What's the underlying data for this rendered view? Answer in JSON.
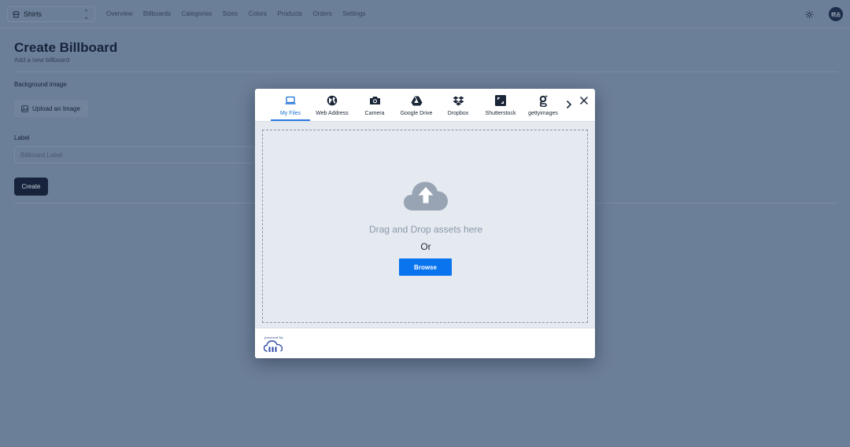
{
  "store_switcher": {
    "label": "Shirts"
  },
  "nav": {
    "items": [
      "Overview",
      "Billboards",
      "Categories",
      "Sizes",
      "Colors",
      "Products",
      "Orders",
      "Settings"
    ]
  },
  "user": {
    "avatar_text": "精选"
  },
  "page": {
    "title": "Create Billboard",
    "subtitle": "Add a new billboard",
    "background_label": "Background image",
    "upload_label": "Upload an Image",
    "label_field_label": "Label",
    "label_placeholder": "Billboard Label",
    "create_label": "Create"
  },
  "upload_widget": {
    "tabs": [
      {
        "label": "My Files",
        "icon": "laptop-icon",
        "active": true
      },
      {
        "label": "Web Address",
        "icon": "globe-icon",
        "active": false
      },
      {
        "label": "Camera",
        "icon": "camera-icon",
        "active": false
      },
      {
        "label": "Google Drive",
        "icon": "google-drive-icon",
        "active": false
      },
      {
        "label": "Dropbox",
        "icon": "dropbox-icon",
        "active": false
      },
      {
        "label": "Shutterstock",
        "icon": "shutterstock-icon",
        "active": false
      },
      {
        "label": "gettyimages",
        "icon": "gettyimages-icon",
        "active": false
      }
    ],
    "drag_text": "Drag and Drop assets here",
    "or_text": "Or",
    "browse_label": "Browse",
    "powered_by": "powered by"
  },
  "colors": {
    "accent": "#0a73ee",
    "overlay": "#6c7f98",
    "primary_dark": "#16233a"
  }
}
